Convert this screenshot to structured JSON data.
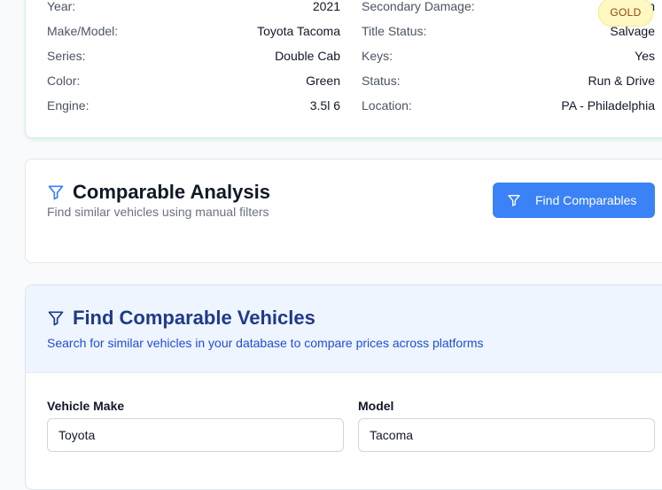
{
  "vehicle_details": {
    "left": [
      {
        "label": "Year:",
        "value": "2021"
      },
      {
        "label": "Make/Model:",
        "value": "Toyota Tacoma"
      },
      {
        "label": "Series:",
        "value": "Double Cab"
      },
      {
        "label": "Color:",
        "value": "Green"
      },
      {
        "label": "Engine:",
        "value": "3.5l 6"
      }
    ],
    "right": [
      {
        "label": "Secondary Damage:",
        "value": "n"
      },
      {
        "label": "Title Status:",
        "value": "Salvage"
      },
      {
        "label": "Keys:",
        "value": "Yes"
      },
      {
        "label": "Status:",
        "value": "Run & Drive"
      },
      {
        "label": "Location:",
        "value": "PA - Philadelphia"
      }
    ],
    "badge": "GOLD"
  },
  "analysis": {
    "title": "Comparable Analysis",
    "subtitle": "Find similar vehicles using manual filters",
    "button_label": "Find Comparables"
  },
  "find": {
    "title": "Find Comparable Vehicles",
    "subtitle": "Search for similar vehicles in your database to compare prices across platforms",
    "make_label": "Vehicle Make",
    "make_value": "Toyota",
    "model_label": "Model",
    "model_value": "Tacoma"
  },
  "colors": {
    "accent": "#3b82f6",
    "title_blue": "#1e3a8a",
    "subtitle_blue": "#1d4ed8",
    "badge_bg": "#fef9c3"
  },
  "icons": [
    "filter-icon"
  ]
}
